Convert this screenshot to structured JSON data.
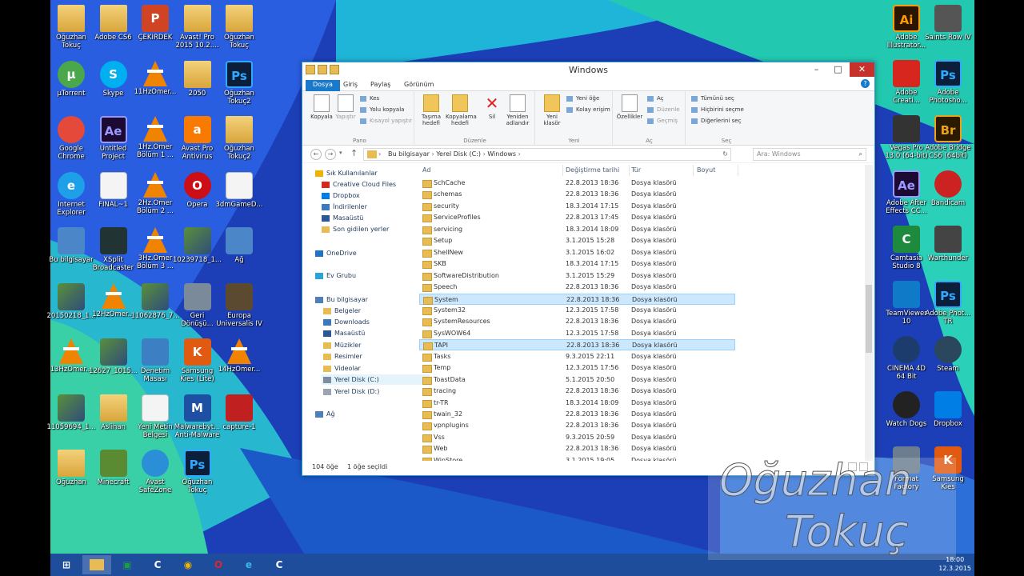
{
  "desktop": {
    "left_icons": [
      {
        "label": "Oğuzhan\nTokuç",
        "glyph": "",
        "kind": "folder"
      },
      {
        "label": "Adobe CS6",
        "glyph": "",
        "kind": "folder"
      },
      {
        "label": "ÇEKİRDEK",
        "glyph": "P",
        "kind": "ppt"
      },
      {
        "label": "Avast! Pro\n2015 10.2....",
        "glyph": "",
        "kind": "folder"
      },
      {
        "label": "Oğuzhan\nTokuç",
        "glyph": "",
        "kind": "folder"
      },
      {
        "label": "µTorrent",
        "glyph": "µ",
        "kind": "utorrent"
      },
      {
        "label": "Skype",
        "glyph": "S",
        "kind": "skype"
      },
      {
        "label": "11HzOmer...",
        "glyph": "",
        "kind": "vlc"
      },
      {
        "label": "2050",
        "glyph": "",
        "kind": "folder"
      },
      {
        "label": "Oğuzhan\nTokuç2",
        "glyph": "Ps",
        "kind": "ps"
      },
      {
        "label": "Google\nChrome",
        "glyph": "",
        "kind": "chrome"
      },
      {
        "label": "Untitled\nProject",
        "glyph": "Ae",
        "kind": "ae"
      },
      {
        "label": "1Hz.Ömer\nBölüm 1 ...",
        "glyph": "",
        "kind": "vlc"
      },
      {
        "label": "Avast Pro\nAntivirus",
        "glyph": "a",
        "kind": "avast"
      },
      {
        "label": "Oğuzhan\nTokuç2",
        "glyph": "",
        "kind": "folder"
      },
      {
        "label": "Internet\nExplorer",
        "glyph": "e",
        "kind": "ie"
      },
      {
        "label": "FINAL~1",
        "glyph": "",
        "kind": "doc"
      },
      {
        "label": "2Hz.Ömer\nBölüm 2 ...",
        "glyph": "",
        "kind": "vlc"
      },
      {
        "label": "Opera",
        "glyph": "O",
        "kind": "opera"
      },
      {
        "label": "3dmGameD...",
        "glyph": "",
        "kind": "doc"
      },
      {
        "label": "Bu bilgisayar",
        "glyph": "",
        "kind": "pc"
      },
      {
        "label": "XSplit\nBroadcaster",
        "glyph": "",
        "kind": "xsplit"
      },
      {
        "label": "3Hz.Ömer\nBölüm 3 ...",
        "glyph": "",
        "kind": "vlc"
      },
      {
        "label": "10239718_1...",
        "glyph": "",
        "kind": "img"
      },
      {
        "label": "Ağ",
        "glyph": "",
        "kind": "pc"
      },
      {
        "label": "20150218_1...",
        "glyph": "",
        "kind": "img"
      },
      {
        "label": "12HzOmer...",
        "glyph": "",
        "kind": "vlc"
      },
      {
        "label": "11062876_7...",
        "glyph": "",
        "kind": "img"
      },
      {
        "label": "Geri\nDönüşü...",
        "glyph": "",
        "kind": "bin"
      },
      {
        "label": "Europa\nUniversalis IV",
        "glyph": "",
        "kind": "eu"
      },
      {
        "label": "13HzOmer...",
        "glyph": "",
        "kind": "vlc"
      },
      {
        "label": "12627_1015...",
        "glyph": "",
        "kind": "img"
      },
      {
        "label": "Denetim\nMasası",
        "glyph": "",
        "kind": "cp"
      },
      {
        "label": "Samsung\nKies (Lite)",
        "glyph": "K",
        "kind": "kies"
      },
      {
        "label": "14HzOmer...",
        "glyph": "",
        "kind": "vlc"
      },
      {
        "label": "11059694_1...",
        "glyph": "",
        "kind": "img"
      },
      {
        "label": "Aslihan",
        "glyph": "",
        "kind": "folder"
      },
      {
        "label": "Yeni Metin\nBelgesi",
        "glyph": "",
        "kind": "doc"
      },
      {
        "label": "Malwarebyt...\nAnti-Malware",
        "glyph": "M",
        "kind": "mbam"
      },
      {
        "label": "capture-1",
        "glyph": "",
        "kind": "capture"
      },
      {
        "label": "Oğuzhan",
        "glyph": "",
        "kind": "folder"
      },
      {
        "label": "Minecraft",
        "glyph": "",
        "kind": "minecraft"
      },
      {
        "label": "Avast\nSafeZone",
        "glyph": "",
        "kind": "safezone"
      },
      {
        "label": "Oğuzhan\nTokuç",
        "glyph": "Ps",
        "kind": "ps"
      }
    ],
    "right_icons": [
      {
        "label": "Adobe\nIllustrator...",
        "glyph": "Ai",
        "kind": "ai"
      },
      {
        "label": "Saints Row IV",
        "glyph": "",
        "kind": "saints"
      },
      {
        "label": "Adobe\nCreati...",
        "glyph": "",
        "kind": "cc"
      },
      {
        "label": "Adobe\nPhotosho...",
        "glyph": "Ps",
        "kind": "ps"
      },
      {
        "label": "Vegas Pro\n13.0 (64-bit)",
        "glyph": "",
        "kind": "vegas"
      },
      {
        "label": "Adobe Bridge\nCS6 (64bit)",
        "glyph": "Br",
        "kind": "br"
      },
      {
        "label": "Adobe After\nEffects CC...",
        "glyph": "Ae",
        "kind": "ae"
      },
      {
        "label": "Bandicam",
        "glyph": "",
        "kind": "bandicam"
      },
      {
        "label": "Camtasia\nStudio 8",
        "glyph": "C",
        "kind": "camtasia"
      },
      {
        "label": "Warthunder",
        "glyph": "",
        "kind": "war"
      },
      {
        "label": "TeamViewer\n10",
        "glyph": "",
        "kind": "tv"
      },
      {
        "label": "Adobe Phot...\nTR",
        "glyph": "Ps",
        "kind": "ps"
      },
      {
        "label": "CINEMA 4D\n64 Bit",
        "glyph": "",
        "kind": "c4d"
      },
      {
        "label": "Steam",
        "glyph": "",
        "kind": "steam"
      },
      {
        "label": "Watch Dogs",
        "glyph": "",
        "kind": "wd"
      },
      {
        "label": "Dropbox",
        "glyph": "",
        "kind": "dropbox"
      },
      {
        "label": "Format\nFactory",
        "glyph": "",
        "kind": "ff"
      },
      {
        "label": "Samsung\nKies",
        "glyph": "K",
        "kind": "kies"
      }
    ]
  },
  "window": {
    "title": "Windows",
    "tabs": [
      "Dosya",
      "Giriş",
      "Paylaş",
      "Görünüm"
    ],
    "ribbon": {
      "pano": {
        "name": "Pano",
        "copy": "Kopyala",
        "paste": "Yapıştır",
        "cut": "Kes",
        "copy_path": "Yolu kopyala",
        "paste_shortcut": "Kısayol yapıştır"
      },
      "duzenle": {
        "name": "Düzenle",
        "move": "Taşıma\nhedefi",
        "copy_to": "Kopyalama\nhedefi",
        "delete": "Sil",
        "rename": "Yeniden\nadlandır"
      },
      "yeni": {
        "name": "Yeni",
        "new_folder": "Yeni\nklasör",
        "new_item": "Yeni öğe",
        "easy_access": "Kolay erişim"
      },
      "ac": {
        "name": "Aç",
        "properties": "Özellikler",
        "open": "Aç",
        "edit": "Düzenle",
        "history": "Geçmiş"
      },
      "sec": {
        "name": "Seç",
        "select_all": "Tümünü seç",
        "select_none": "Hiçbirini seçme",
        "invert": "Diğerlerini seç"
      }
    },
    "address": {
      "path": [
        "Bu bilgisayar",
        "Yerel Disk (C:)",
        "Windows"
      ],
      "search_placeholder": "Ara: Windows"
    },
    "nav_pane": [
      {
        "label": "Sık Kullanılanlar",
        "color": "#f0b400"
      },
      {
        "label": "Creative Cloud Files",
        "color": "#d7261e"
      },
      {
        "label": "Dropbox",
        "color": "#007ee5"
      },
      {
        "label": "İndirilenler",
        "color": "#3a78c2"
      },
      {
        "label": "Masaüstü",
        "color": "#2b5797"
      },
      {
        "label": "Son gidilen yerler",
        "color": "#e8bc55"
      },
      {
        "label": "OneDrive",
        "color": "#1e73c9"
      },
      {
        "label": "Ev Grubu",
        "color": "#2aa3d6"
      },
      {
        "label": "Bu bilgisayar",
        "color": "#4f7fb7"
      },
      {
        "label": "Belgeler",
        "color": "#e8bc55"
      },
      {
        "label": "Downloads",
        "color": "#3a78c2"
      },
      {
        "label": "Masaüstü",
        "color": "#2b5797"
      },
      {
        "label": "Müzikler",
        "color": "#e8bc55"
      },
      {
        "label": "Resimler",
        "color": "#e8bc55"
      },
      {
        "label": "Videolar",
        "color": "#e8bc55"
      },
      {
        "label": "Yerel Disk (C:)",
        "color": "#7d8da0"
      },
      {
        "label": "Yerel Disk (D:)",
        "color": "#9aa5b1"
      },
      {
        "label": "Ağ",
        "color": "#4f7fb7"
      }
    ],
    "columns": [
      "Ad",
      "Değiştirme tarihi",
      "Tür",
      "Boyut"
    ],
    "files": [
      {
        "name": "SchCache",
        "date": "22.8.2013 18:36",
        "type": "Dosya klasörü"
      },
      {
        "name": "schemas",
        "date": "22.8.2013 18:36",
        "type": "Dosya klasörü"
      },
      {
        "name": "security",
        "date": "18.3.2014 17:15",
        "type": "Dosya klasörü"
      },
      {
        "name": "ServiceProfiles",
        "date": "22.8.2013 17:45",
        "type": "Dosya klasörü"
      },
      {
        "name": "servicing",
        "date": "18.3.2014 18:09",
        "type": "Dosya klasörü"
      },
      {
        "name": "Setup",
        "date": "3.1.2015 15:28",
        "type": "Dosya klasörü"
      },
      {
        "name": "ShellNew",
        "date": "3.1.2015 16:02",
        "type": "Dosya klasörü"
      },
      {
        "name": "SKB",
        "date": "18.3.2014 17:15",
        "type": "Dosya klasörü"
      },
      {
        "name": "SoftwareDistribution",
        "date": "3.1.2015 15:29",
        "type": "Dosya klasörü"
      },
      {
        "name": "Speech",
        "date": "22.8.2013 18:36",
        "type": "Dosya klasörü"
      },
      {
        "name": "System",
        "date": "22.8.2013 18:36",
        "type": "Dosya klasörü",
        "selected": true
      },
      {
        "name": "System32",
        "date": "12.3.2015 17:58",
        "type": "Dosya klasörü"
      },
      {
        "name": "SystemResources",
        "date": "22.8.2013 18:36",
        "type": "Dosya klasörü"
      },
      {
        "name": "SysWOW64",
        "date": "12.3.2015 17:58",
        "type": "Dosya klasörü"
      },
      {
        "name": "TAPI",
        "date": "22.8.2013 18:36",
        "type": "Dosya klasörü",
        "selected": true
      },
      {
        "name": "Tasks",
        "date": "9.3.2015 22:11",
        "type": "Dosya klasörü"
      },
      {
        "name": "Temp",
        "date": "12.3.2015 17:56",
        "type": "Dosya klasörü"
      },
      {
        "name": "ToastData",
        "date": "5.1.2015 20:50",
        "type": "Dosya klasörü"
      },
      {
        "name": "tracing",
        "date": "22.8.2013 18:36",
        "type": "Dosya klasörü"
      },
      {
        "name": "tr-TR",
        "date": "18.3.2014 18:09",
        "type": "Dosya klasörü"
      },
      {
        "name": "twain_32",
        "date": "22.8.2013 18:36",
        "type": "Dosya klasörü"
      },
      {
        "name": "vpnplugins",
        "date": "22.8.2013 18:36",
        "type": "Dosya klasörü"
      },
      {
        "name": "Vss",
        "date": "9.3.2015 20:59",
        "type": "Dosya klasörü"
      },
      {
        "name": "Web",
        "date": "22.8.2013 18:36",
        "type": "Dosya klasörü"
      },
      {
        "name": "WinStore",
        "date": "3.1.2015 19:05",
        "type": "Dosya klasörü"
      }
    ],
    "status": {
      "count": "104 öğe",
      "selected": "1 öğe seçildi"
    }
  },
  "taskbar": {
    "clock_time": "18:00",
    "clock_date": "12.3.2015"
  },
  "watermark": {
    "line1": "Oğuzhan",
    "line2": "Tokuç"
  },
  "colors": {
    "accent": "#1979ca",
    "selection": "#cce8ff",
    "close": "#c7312b",
    "desktop": "#1a4fc0"
  }
}
